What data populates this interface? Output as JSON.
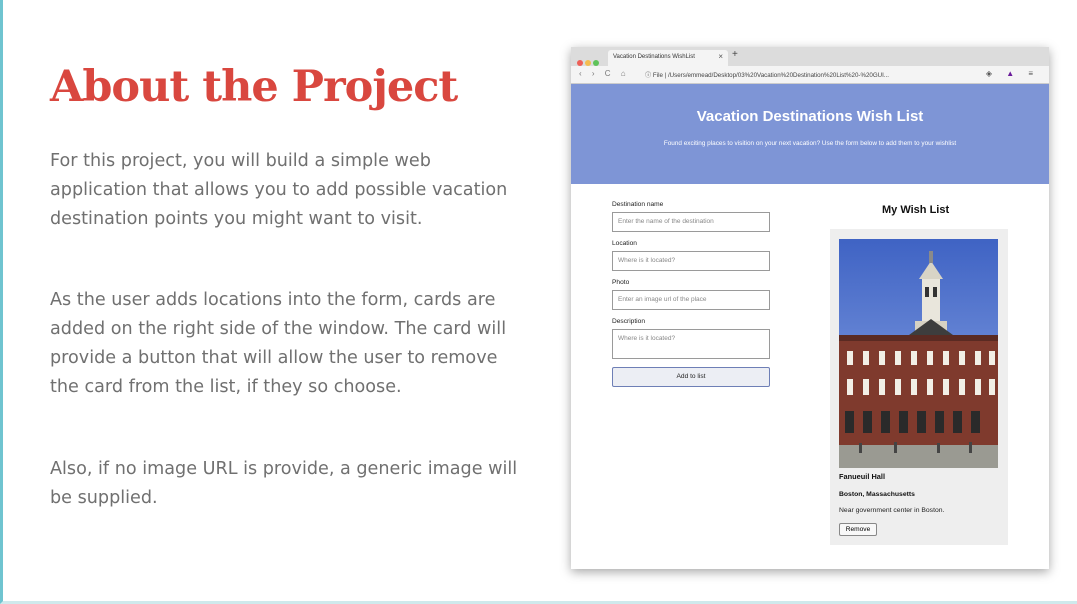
{
  "slide": {
    "title": "About the Project",
    "paragraphs": [
      "For this project, you will build a simple web application that allows you to add possible vacation destination points you might want to visit.",
      "As the user adds locations into the form, cards are added on the right side of the window. The card will provide a button that will allow the user to remove the card from the list, if they so choose.",
      "Also, if no image URL is provide, a generic image will be supplied."
    ]
  },
  "browser": {
    "tab_title": "Vacation Destinations WishList",
    "tab_close": "×",
    "new_tab": "+",
    "nav_icons": "‹ › C ⌂",
    "url_prefix": "File",
    "url": "/Users/emmead/Desktop/03%20Vacation%20Destination%20List%20-%20GUI...",
    "page": {
      "heading": "Vacation Destinations Wish List",
      "subheading": "Found exciting places to visition on your next vacation? Use the form below to add them to your wishlist",
      "form": {
        "destination_label": "Destination name",
        "destination_placeholder": "Enter the name of the destination",
        "location_label": "Location",
        "location_placeholder": "Where is it located?",
        "photo_label": "Photo",
        "photo_placeholder": "Enter an image url of the place",
        "description_label": "Description",
        "description_placeholder": "Where is it located?",
        "submit_label": "Add to list"
      },
      "wishlist": {
        "heading": "My Wish List",
        "cards": [
          {
            "name": "Fanueuil Hall",
            "location": "Boston, Massachusetts",
            "description": "Near government center in Boston.",
            "remove_label": "Remove"
          }
        ]
      }
    }
  },
  "colors": {
    "title": "#d9473f",
    "body_text": "#707070",
    "banner": "#7e95d6",
    "slide_accent": "#6fc4d0"
  }
}
